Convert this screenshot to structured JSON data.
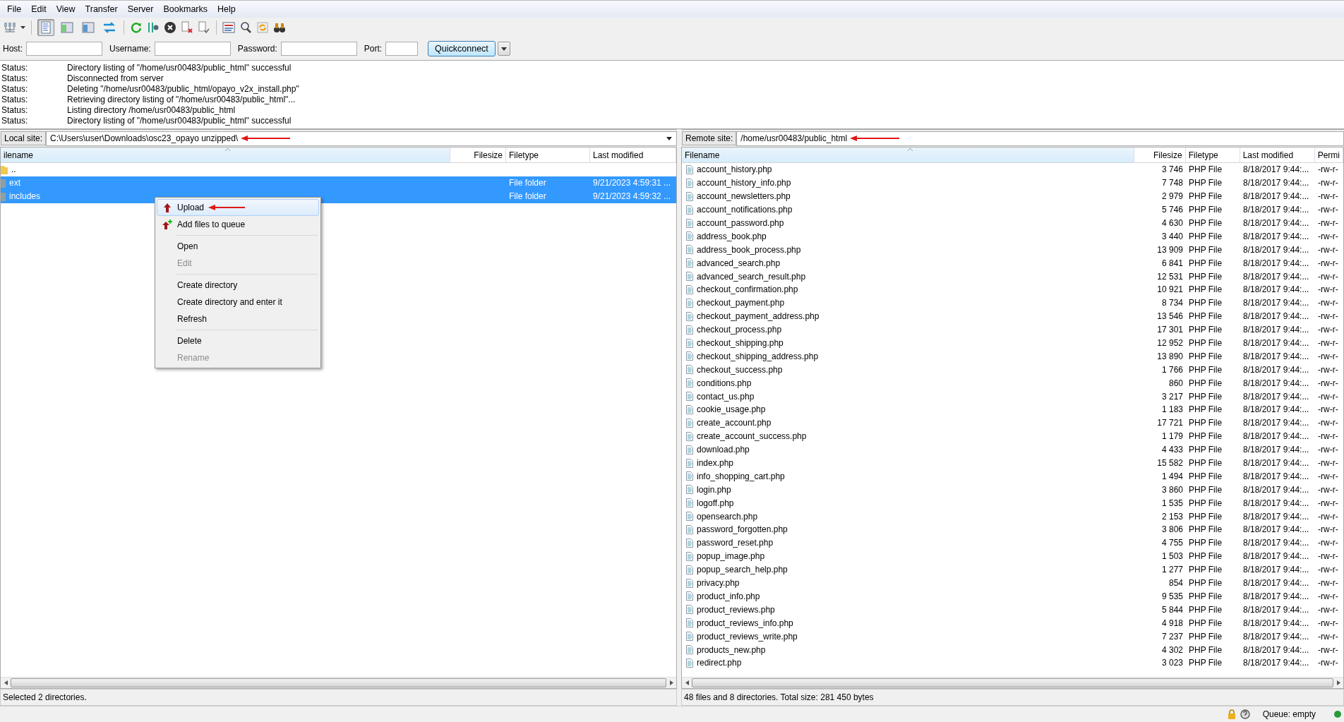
{
  "menu": [
    "File",
    "Edit",
    "View",
    "Transfer",
    "Server",
    "Bookmarks",
    "Help"
  ],
  "toolbar": {
    "toggles": [
      {
        "selected": true
      },
      {
        "selected": false
      },
      {
        "selected": false
      },
      {
        "selected": false
      }
    ]
  },
  "quickconnect": {
    "fields": [
      {
        "label": "Host:"
      },
      {
        "label": "Username:"
      },
      {
        "label": "Password:"
      },
      {
        "label": "Port:"
      }
    ],
    "button": "Quickconnect"
  },
  "log": [
    {
      "label": "Status:",
      "message": "Directory listing of \"/home/usr00483/public_html\" successful"
    },
    {
      "label": "Status:",
      "message": "Disconnected from server"
    },
    {
      "label": "Status:",
      "message": "Deleting \"/home/usr00483/public_html/opayo_v2x_install.php\""
    },
    {
      "label": "Status:",
      "message": "Retrieving directory listing of \"/home/usr00483/public_html\"..."
    },
    {
      "label": "Status:",
      "message": "Listing directory /home/usr00483/public_html"
    },
    {
      "label": "Status:",
      "message": "Directory listing of \"/home/usr00483/public_html\" successful"
    }
  ],
  "local": {
    "site_label": "Local site:",
    "path": "C:\\Users\\user\\Downloads\\osc23_opayo unzipped\\",
    "annotated": true,
    "columns": [
      "ilename",
      "Filesize",
      "Filetype",
      "Last modified"
    ],
    "rows": [
      {
        "kind": "parent",
        "name": "..",
        "selected": false
      },
      {
        "kind": "folder",
        "name": "ext",
        "filetype": "File folder",
        "modified": "9/21/2023 4:59:31 ...",
        "selected": true
      },
      {
        "kind": "folder",
        "name": "includes",
        "filetype": "File folder",
        "modified": "9/21/2023 4:59:32 ...",
        "selected": true
      }
    ],
    "status": "Selected 2 directories."
  },
  "context_menu": [
    {
      "kind": "upload",
      "label": "Upload",
      "selected": true,
      "disabled": false,
      "annotated": true
    },
    {
      "kind": "queue",
      "label": "Add files to queue",
      "selected": false,
      "disabled": false,
      "annotated": false
    },
    {
      "kind": "separator"
    },
    {
      "kind": "item",
      "label": "Open",
      "selected": false,
      "disabled": false,
      "annotated": false
    },
    {
      "kind": "item",
      "label": "Edit",
      "selected": false,
      "disabled": true,
      "annotated": false
    },
    {
      "kind": "separator"
    },
    {
      "kind": "item",
      "label": "Create directory",
      "selected": false,
      "disabled": false,
      "annotated": false
    },
    {
      "kind": "item",
      "label": "Create directory and enter it",
      "selected": false,
      "disabled": false,
      "annotated": false
    },
    {
      "kind": "item",
      "label": "Refresh",
      "selected": false,
      "disabled": false,
      "annotated": false
    },
    {
      "kind": "separator"
    },
    {
      "kind": "item",
      "label": "Delete",
      "selected": false,
      "disabled": false,
      "annotated": false
    },
    {
      "kind": "item",
      "label": "Rename",
      "selected": false,
      "disabled": true,
      "annotated": false
    }
  ],
  "remote": {
    "site_label": "Remote site:",
    "path": "/home/usr00483/public_html",
    "annotated": true,
    "columns": [
      "Filename",
      "Filesize",
      "Filetype",
      "Last modified",
      "Permi"
    ],
    "rows": [
      {
        "name": "account_history.php",
        "filesize": "3 746",
        "filetype": "PHP File",
        "modified": "8/18/2017 9:44:...",
        "permissions": "-rw-r-"
      },
      {
        "name": "account_history_info.php",
        "filesize": "7 748",
        "filetype": "PHP File",
        "modified": "8/18/2017 9:44:...",
        "permissions": "-rw-r-"
      },
      {
        "name": "account_newsletters.php",
        "filesize": "2 979",
        "filetype": "PHP File",
        "modified": "8/18/2017 9:44:...",
        "permissions": "-rw-r-"
      },
      {
        "name": "account_notifications.php",
        "filesize": "5 746",
        "filetype": "PHP File",
        "modified": "8/18/2017 9:44:...",
        "permissions": "-rw-r-"
      },
      {
        "name": "account_password.php",
        "filesize": "4 630",
        "filetype": "PHP File",
        "modified": "8/18/2017 9:44:...",
        "permissions": "-rw-r-"
      },
      {
        "name": "address_book.php",
        "filesize": "3 440",
        "filetype": "PHP File",
        "modified": "8/18/2017 9:44:...",
        "permissions": "-rw-r-"
      },
      {
        "name": "address_book_process.php",
        "filesize": "13 909",
        "filetype": "PHP File",
        "modified": "8/18/2017 9:44:...",
        "permissions": "-rw-r-"
      },
      {
        "name": "advanced_search.php",
        "filesize": "6 841",
        "filetype": "PHP File",
        "modified": "8/18/2017 9:44:...",
        "permissions": "-rw-r-"
      },
      {
        "name": "advanced_search_result.php",
        "filesize": "12 531",
        "filetype": "PHP File",
        "modified": "8/18/2017 9:44:...",
        "permissions": "-rw-r-"
      },
      {
        "name": "checkout_confirmation.php",
        "filesize": "10 921",
        "filetype": "PHP File",
        "modified": "8/18/2017 9:44:...",
        "permissions": "-rw-r-"
      },
      {
        "name": "checkout_payment.php",
        "filesize": "8 734",
        "filetype": "PHP File",
        "modified": "8/18/2017 9:44:...",
        "permissions": "-rw-r-"
      },
      {
        "name": "checkout_payment_address.php",
        "filesize": "13 546",
        "filetype": "PHP File",
        "modified": "8/18/2017 9:44:...",
        "permissions": "-rw-r-"
      },
      {
        "name": "checkout_process.php",
        "filesize": "17 301",
        "filetype": "PHP File",
        "modified": "8/18/2017 9:44:...",
        "permissions": "-rw-r-"
      },
      {
        "name": "checkout_shipping.php",
        "filesize": "12 952",
        "filetype": "PHP File",
        "modified": "8/18/2017 9:44:...",
        "permissions": "-rw-r-"
      },
      {
        "name": "checkout_shipping_address.php",
        "filesize": "13 890",
        "filetype": "PHP File",
        "modified": "8/18/2017 9:44:...",
        "permissions": "-rw-r-"
      },
      {
        "name": "checkout_success.php",
        "filesize": "1 766",
        "filetype": "PHP File",
        "modified": "8/18/2017 9:44:...",
        "permissions": "-rw-r-"
      },
      {
        "name": "conditions.php",
        "filesize": "860",
        "filetype": "PHP File",
        "modified": "8/18/2017 9:44:...",
        "permissions": "-rw-r-"
      },
      {
        "name": "contact_us.php",
        "filesize": "3 217",
        "filetype": "PHP File",
        "modified": "8/18/2017 9:44:...",
        "permissions": "-rw-r-"
      },
      {
        "name": "cookie_usage.php",
        "filesize": "1 183",
        "filetype": "PHP File",
        "modified": "8/18/2017 9:44:...",
        "permissions": "-rw-r-"
      },
      {
        "name": "create_account.php",
        "filesize": "17 721",
        "filetype": "PHP File",
        "modified": "8/18/2017 9:44:...",
        "permissions": "-rw-r-"
      },
      {
        "name": "create_account_success.php",
        "filesize": "1 179",
        "filetype": "PHP File",
        "modified": "8/18/2017 9:44:...",
        "permissions": "-rw-r-"
      },
      {
        "name": "download.php",
        "filesize": "4 433",
        "filetype": "PHP File",
        "modified": "8/18/2017 9:44:...",
        "permissions": "-rw-r-"
      },
      {
        "name": "index.php",
        "filesize": "15 582",
        "filetype": "PHP File",
        "modified": "8/18/2017 9:44:...",
        "permissions": "-rw-r-"
      },
      {
        "name": "info_shopping_cart.php",
        "filesize": "1 494",
        "filetype": "PHP File",
        "modified": "8/18/2017 9:44:...",
        "permissions": "-rw-r-"
      },
      {
        "name": "login.php",
        "filesize": "3 860",
        "filetype": "PHP File",
        "modified": "8/18/2017 9:44:...",
        "permissions": "-rw-r-"
      },
      {
        "name": "logoff.php",
        "filesize": "1 535",
        "filetype": "PHP File",
        "modified": "8/18/2017 9:44:...",
        "permissions": "-rw-r-"
      },
      {
        "name": "opensearch.php",
        "filesize": "2 153",
        "filetype": "PHP File",
        "modified": "8/18/2017 9:44:...",
        "permissions": "-rw-r-"
      },
      {
        "name": "password_forgotten.php",
        "filesize": "3 806",
        "filetype": "PHP File",
        "modified": "8/18/2017 9:44:...",
        "permissions": "-rw-r-"
      },
      {
        "name": "password_reset.php",
        "filesize": "4 755",
        "filetype": "PHP File",
        "modified": "8/18/2017 9:44:...",
        "permissions": "-rw-r-"
      },
      {
        "name": "popup_image.php",
        "filesize": "1 503",
        "filetype": "PHP File",
        "modified": "8/18/2017 9:44:...",
        "permissions": "-rw-r-"
      },
      {
        "name": "popup_search_help.php",
        "filesize": "1 277",
        "filetype": "PHP File",
        "modified": "8/18/2017 9:44:...",
        "permissions": "-rw-r-"
      },
      {
        "name": "privacy.php",
        "filesize": "854",
        "filetype": "PHP File",
        "modified": "8/18/2017 9:44:...",
        "permissions": "-rw-r-"
      },
      {
        "name": "product_info.php",
        "filesize": "9 535",
        "filetype": "PHP File",
        "modified": "8/18/2017 9:44:...",
        "permissions": "-rw-r-"
      },
      {
        "name": "product_reviews.php",
        "filesize": "5 844",
        "filetype": "PHP File",
        "modified": "8/18/2017 9:44:...",
        "permissions": "-rw-r-"
      },
      {
        "name": "product_reviews_info.php",
        "filesize": "4 918",
        "filetype": "PHP File",
        "modified": "8/18/2017 9:44:...",
        "permissions": "-rw-r-"
      },
      {
        "name": "product_reviews_write.php",
        "filesize": "7 237",
        "filetype": "PHP File",
        "modified": "8/18/2017 9:44:...",
        "permissions": "-rw-r-"
      },
      {
        "name": "products_new.php",
        "filesize": "4 302",
        "filetype": "PHP File",
        "modified": "8/18/2017 9:44:...",
        "permissions": "-rw-r-"
      },
      {
        "name": "redirect.php",
        "filesize": "3 023",
        "filetype": "PHP File",
        "modified": "8/18/2017 9:44:...",
        "permissions": "-rw-r-"
      }
    ],
    "status": "48 files and 8 directories. Total size: 281 450 bytes"
  },
  "bottom_bar": {
    "queue": "Queue: empty"
  }
}
